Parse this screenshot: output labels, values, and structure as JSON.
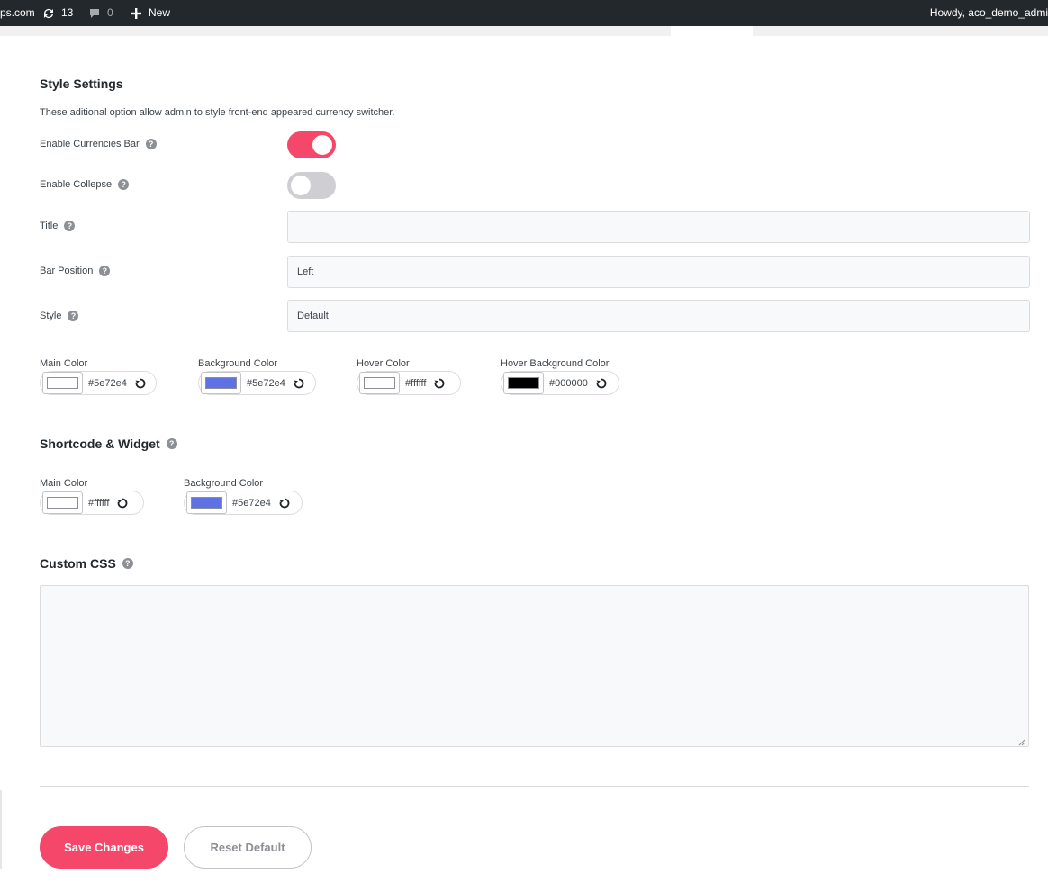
{
  "admin_bar": {
    "site_label": "ps.com",
    "updates_count": "13",
    "comments_count": "0",
    "new_label": "New",
    "howdy": "Howdy, aco_demo_admi"
  },
  "style_settings": {
    "heading": "Style Settings",
    "description": "These aditional option allow admin to style front-end appeared currency switcher.",
    "enable_currencies_bar": {
      "label": "Enable Currencies Bar",
      "value": true
    },
    "enable_collapse": {
      "label": "Enable Collepse",
      "value": false
    },
    "title": {
      "label": "Title",
      "value": ""
    },
    "bar_position": {
      "label": "Bar Position",
      "value": "Left"
    },
    "style": {
      "label": "Style",
      "value": "Default"
    },
    "colors": [
      {
        "label": "Main Color",
        "hex": "#5e72e4",
        "swatch": "#ffffff"
      },
      {
        "label": "Background Color",
        "hex": "#5e72e4",
        "swatch": "#5e72e4"
      },
      {
        "label": "Hover Color",
        "hex": "#ffffff",
        "swatch": "#ffffff"
      },
      {
        "label": "Hover Background Color",
        "hex": "#000000",
        "swatch": "#000000"
      }
    ]
  },
  "shortcode_widget": {
    "heading": "Shortcode & Widget",
    "colors": [
      {
        "label": "Main Color",
        "hex": "#ffffff",
        "swatch": "#ffffff"
      },
      {
        "label": "Background Color",
        "hex": "#5e72e4",
        "swatch": "#5e72e4"
      }
    ]
  },
  "custom_css": {
    "heading": "Custom CSS",
    "value": ""
  },
  "actions": {
    "save_label": "Save Changes",
    "reset_label": "Reset Default"
  },
  "theme": {
    "accent": "#f5476a",
    "toggle_off": "#cfcfd3",
    "admin_bar_bg": "#23282d"
  }
}
